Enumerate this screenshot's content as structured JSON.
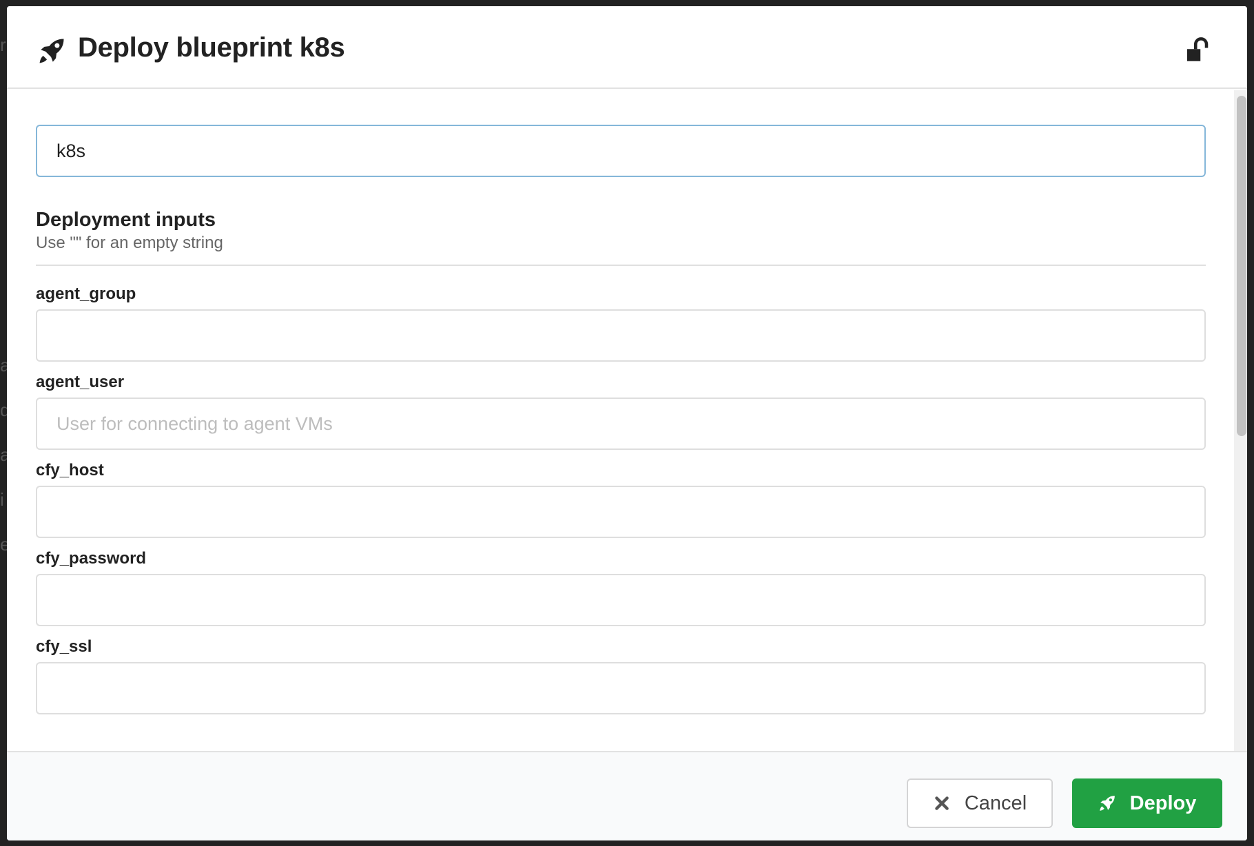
{
  "modal": {
    "title": "Deploy blueprint k8s",
    "deployment_name": "k8s"
  },
  "inputs_section": {
    "title": "Deployment inputs",
    "subtitle": "Use \"\" for an empty string"
  },
  "fields": [
    {
      "label": "agent_group",
      "value": "",
      "placeholder": ""
    },
    {
      "label": "agent_user",
      "value": "",
      "placeholder": "User for connecting to agent VMs"
    },
    {
      "label": "cfy_host",
      "value": "",
      "placeholder": ""
    },
    {
      "label": "cfy_password",
      "value": "",
      "placeholder": ""
    },
    {
      "label": "cfy_ssl",
      "value": "",
      "placeholder": ""
    }
  ],
  "footer": {
    "cancel_label": "Cancel",
    "deploy_label": "Deploy"
  },
  "colors": {
    "deploy_button": "#21a143",
    "focused_input_border": "#85b7d9"
  },
  "icons": {
    "header": "rocket-icon",
    "lock": "unlock-icon",
    "cancel": "close-icon",
    "deploy": "rocket-icon"
  }
}
